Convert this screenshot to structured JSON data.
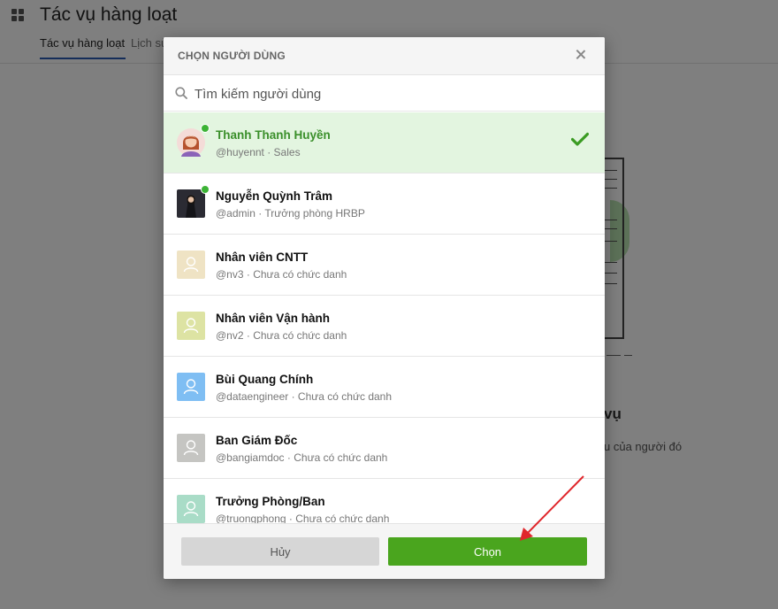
{
  "background": {
    "page_title": "Tác vụ hàng loạt",
    "tabs": [
      {
        "label": "Tác vụ hàng loạt"
      },
      {
        "label": "Lịch sử"
      }
    ],
    "empty_title_fragment": "vụ",
    "empty_desc_fragment": "u của người đó"
  },
  "modal": {
    "title": "CHỌN NGƯỜI DÙNG",
    "search": {
      "placeholder": "Tìm kiếm người dùng",
      "value": ""
    },
    "users": [
      {
        "name": "Thanh Thanh Huyền",
        "sub": "@huyennt · Sales",
        "selected": true,
        "online": true,
        "avatar_icon": "woman-avatar-icon",
        "avatar_color": "#f4dcd8"
      },
      {
        "name": "Nguyễn Quỳnh Trâm",
        "sub": "@admin · Trưởng phòng HRBP",
        "selected": false,
        "online": true,
        "avatar_icon": "photo-avatar-icon",
        "avatar_color": "#2b2b33"
      },
      {
        "name": "Nhân viên CNTT",
        "sub": "@nv3 · Chưa có chức danh",
        "selected": false,
        "online": false,
        "avatar_icon": "person-icon",
        "avatar_color": "#efe3c4"
      },
      {
        "name": "Nhân viên Vận hành",
        "sub": "@nv2 · Chưa có chức danh",
        "selected": false,
        "online": false,
        "avatar_icon": "person-icon",
        "avatar_color": "#dde3a3"
      },
      {
        "name": "Bùi Quang Chính",
        "sub": "@dataengineer · Chưa có chức danh",
        "selected": false,
        "online": false,
        "avatar_icon": "person-icon",
        "avatar_color": "#7fbef3"
      },
      {
        "name": "Ban Giám Đốc",
        "sub": "@bangiamdoc · Chưa có chức danh",
        "selected": false,
        "online": false,
        "avatar_icon": "person-icon",
        "avatar_color": "#c5c5c2"
      },
      {
        "name": "Trưởng Phòng/Ban",
        "sub": "@truongphong · Chưa có chức danh",
        "selected": false,
        "online": false,
        "avatar_icon": "person-icon",
        "avatar_color": "#a9dcc7"
      }
    ],
    "footer": {
      "cancel_label": "Hủy",
      "choose_label": "Chọn"
    }
  },
  "colors": {
    "accent_green": "#4aa51e",
    "selected_row": "#e3f5e0",
    "online_dot": "#3cb335",
    "annotation_arrow": "#e0262b"
  }
}
